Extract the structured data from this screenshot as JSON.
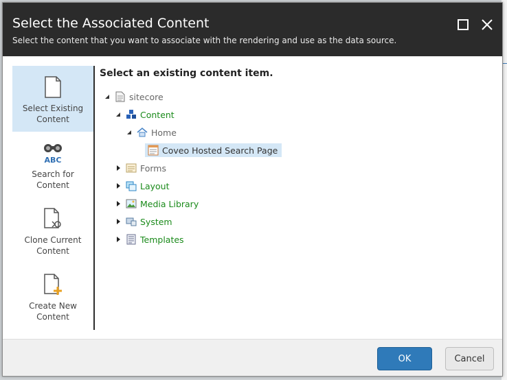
{
  "dialog": {
    "title": "Select the Associated Content",
    "subtitle": "Select the content that you want to associate with the rendering and use as the data source."
  },
  "sidebar": {
    "items": [
      {
        "label": "Select Existing Content",
        "icon": "document-icon",
        "active": true
      },
      {
        "label": "Search for Content",
        "icon": "binoculars-abc-icon",
        "active": false
      },
      {
        "label": "Clone Current Content",
        "icon": "clone-document-icon",
        "active": false
      },
      {
        "label": "Create New Content",
        "icon": "new-document-icon",
        "active": false
      }
    ]
  },
  "main": {
    "heading": "Select an existing content item."
  },
  "tree": {
    "sitecore": "sitecore",
    "content": "Content",
    "home": "Home",
    "coveo": "Coveo Hosted Search Page",
    "forms": "Forms",
    "layout": "Layout",
    "media": "Media Library",
    "system": "System",
    "templates": "Templates"
  },
  "footer": {
    "ok_label": "OK",
    "cancel_label": "Cancel"
  },
  "colors": {
    "header_bg": "#2b2b2b",
    "selected_bg": "#d4e7f6",
    "primary_button": "#2f7ab9",
    "tree_green": "#1a8a1a"
  }
}
